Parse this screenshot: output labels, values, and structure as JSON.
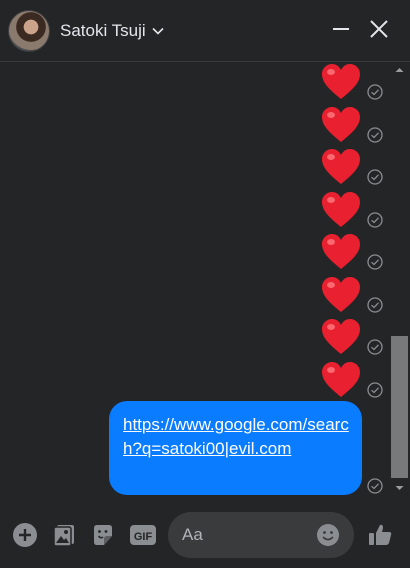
{
  "header": {
    "contact_name": "Satoki Tsuji",
    "avatar_icon": "user-avatar",
    "chevron_icon": "chevron-down-icon",
    "minimize_icon": "minimize-icon",
    "close_icon": "close-icon"
  },
  "messages": {
    "hearts": [
      {
        "emoji": "heart",
        "status": "seen"
      },
      {
        "emoji": "heart",
        "status": "seen"
      },
      {
        "emoji": "heart",
        "status": "seen"
      },
      {
        "emoji": "heart",
        "status": "seen"
      },
      {
        "emoji": "heart",
        "status": "seen"
      },
      {
        "emoji": "heart",
        "status": "seen"
      },
      {
        "emoji": "heart",
        "status": "seen"
      },
      {
        "emoji": "heart",
        "status": "seen"
      }
    ],
    "link_message": {
      "text": "https://www.google.com/search?q=satoki00|evil.com",
      "status": "seen"
    }
  },
  "composer": {
    "placeholder": "Aa",
    "icons": [
      "plus-icon",
      "photo-icon",
      "sticker-icon",
      "gif-icon",
      "emoji-icon",
      "thumbs-up-icon"
    ]
  },
  "colors": {
    "background": "#242526",
    "bubble": "#0a7cff",
    "heart": "#e8202f",
    "input": "#3a3b3c"
  }
}
